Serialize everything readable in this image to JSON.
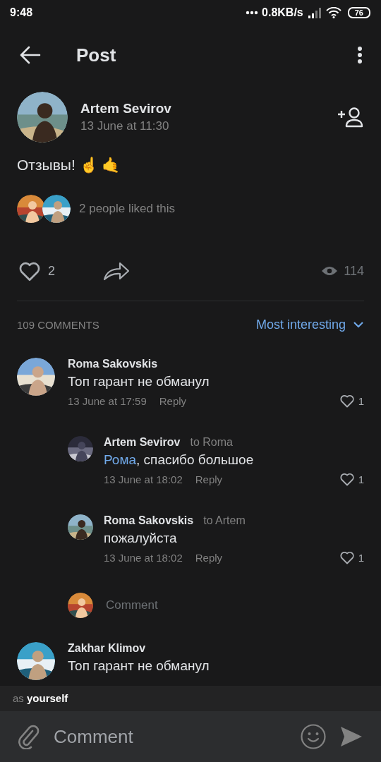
{
  "status_bar": {
    "time": "9:48",
    "speed": "0.8KB/s",
    "battery": "76"
  },
  "header": {
    "title": "Post"
  },
  "post": {
    "author": "Artem Sevirov",
    "date": "13 June at 11:30",
    "text": "Отзывы! ☝️ 🤙",
    "liked_text": "2 people liked this",
    "likes": "2",
    "views": "114",
    "liked": false
  },
  "comments_header": {
    "count": "109 COMMENTS",
    "sort": "Most interesting"
  },
  "comments": [
    {
      "author": "Roma Sakovskis",
      "text": "Топ гарант не обманул",
      "date": "13 June at 17:59",
      "reply": "Reply",
      "likes": "1",
      "liked": false,
      "children": [
        {
          "author": "Artem Sevirov",
          "to": "to Roma",
          "mention": "Рома",
          "text": ", спасибо большое",
          "date": "13 June at 18:02",
          "reply": "Reply",
          "likes": "1",
          "liked": false
        },
        {
          "author": "Roma Sakovskis",
          "to": "to Artem",
          "text": "пожалуйста",
          "date": "13 June at 18:02",
          "reply": "Reply",
          "likes": "1",
          "liked": false
        }
      ],
      "comment_field": {
        "placeholder": "Comment"
      }
    },
    {
      "author": "Zakhar Klimov",
      "text": "Топ гарант не обманул"
    }
  ],
  "composer": {
    "as_label": "as",
    "as_value": "yourself",
    "placeholder": "Comment"
  }
}
